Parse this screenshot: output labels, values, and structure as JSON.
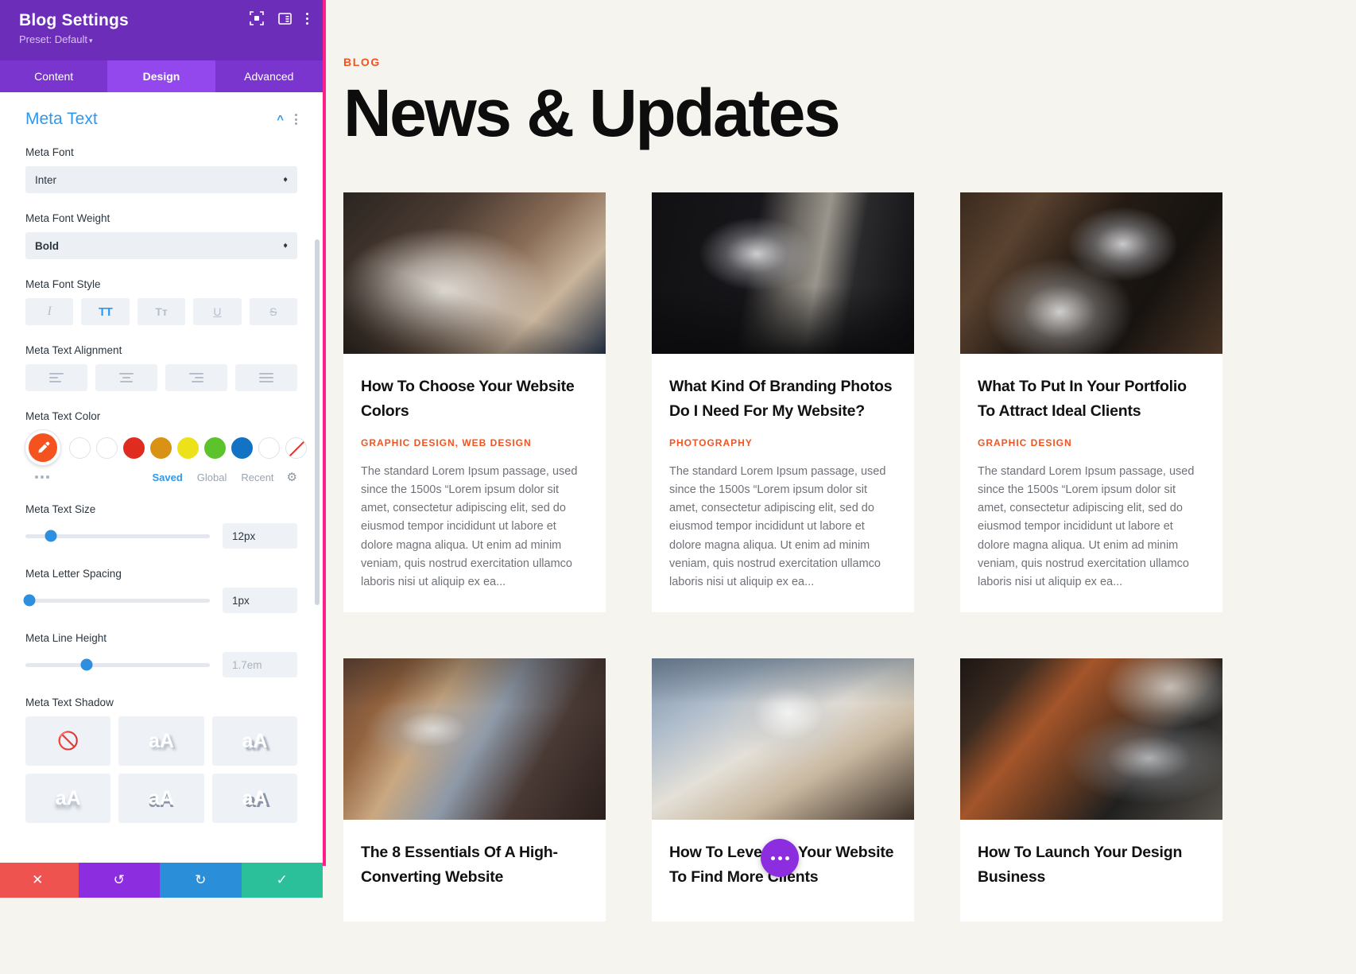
{
  "panel": {
    "title": "Blog Settings",
    "preset": "Preset: Default",
    "preset_caret": "▾",
    "icons": {
      "focus": "focus-icon",
      "layout": "layout-icon",
      "more": "more-vertical-icon"
    },
    "tabs": [
      {
        "label": "Content",
        "active": false
      },
      {
        "label": "Design",
        "active": true
      },
      {
        "label": "Advanced",
        "active": false
      }
    ],
    "section": {
      "title": "Meta Text",
      "collapse_icon": "chevron-up-icon",
      "more_icon": "more-vertical-icon"
    },
    "fields": {
      "meta_font": {
        "label": "Meta Font",
        "value": "Inter"
      },
      "meta_font_weight": {
        "label": "Meta Font Weight",
        "value": "Bold"
      },
      "meta_font_style": {
        "label": "Meta Font Style",
        "buttons": [
          {
            "name": "italic",
            "glyph": "I",
            "active": false
          },
          {
            "name": "uppercase",
            "glyph": "TT",
            "active": true
          },
          {
            "name": "small-caps",
            "glyph": "Tт",
            "active": false
          },
          {
            "name": "underline",
            "glyph": "U",
            "active": false
          },
          {
            "name": "strikethrough",
            "glyph": "S",
            "active": false
          }
        ]
      },
      "meta_text_alignment": {
        "label": "Meta Text Alignment",
        "buttons": [
          "left",
          "center",
          "right",
          "justify"
        ]
      },
      "meta_text_color": {
        "label": "Meta Text Color",
        "selected": "#f4531f",
        "swatches": [
          "#ffffff",
          "#ffffff",
          "#e02b20",
          "#d99213",
          "#ede21a",
          "#5cc32c",
          "#1272c4",
          "#ffffff",
          "none"
        ],
        "tabs": [
          {
            "label": "Saved",
            "active": true
          },
          {
            "label": "Global",
            "active": false
          },
          {
            "label": "Recent",
            "active": false
          }
        ],
        "gear_icon": "gear-icon"
      },
      "meta_text_size": {
        "label": "Meta Text Size",
        "value": "12px",
        "pct": 14
      },
      "meta_letter_spacing": {
        "label": "Meta Letter Spacing",
        "value": "1px",
        "pct": 2
      },
      "meta_line_height": {
        "label": "Meta Line Height",
        "value": "1.7em",
        "pct": 33,
        "is_placeholder": true
      },
      "meta_text_shadow": {
        "label": "Meta Text Shadow",
        "options": [
          "none",
          "aA",
          "aA",
          "aA",
          "aA",
          "aA"
        ]
      }
    },
    "footer": [
      {
        "name": "close",
        "glyph": "✕"
      },
      {
        "name": "undo",
        "glyph": "↺"
      },
      {
        "name": "redo",
        "glyph": "↻"
      },
      {
        "name": "save",
        "glyph": "✓"
      }
    ]
  },
  "page": {
    "eyebrow": "BLOG",
    "title": "News & Updates",
    "excerpt": "The standard Lorem Ipsum passage, used since the 1500s “Lorem ipsum dolor sit amet, consectetur adipiscing elit, sed do eiusmod tempor incididunt ut labore et dolore magna aliqua. Ut enim ad minim veniam, quis nostrud exercitation ullamco laboris nisi ut aliquip ex ea...",
    "cards": [
      {
        "title": "How To Choose Your Website Colors",
        "meta": "GRAPHIC DESIGN, WEB DESIGN",
        "image": "woman-sketching-wireframe"
      },
      {
        "title": "What Kind Of Branding Photos Do I Need For My Website?",
        "meta": "PHOTOGRAPHY",
        "image": "imac-on-desk-by-window"
      },
      {
        "title": "What To Put In Your Portfolio To Attract Ideal Clients",
        "meta": "GRAPHIC DESIGN",
        "image": "laptop-and-chair-on-wood-desk"
      },
      {
        "title": "The 8 Essentials Of A High-Converting Website",
        "meta": "",
        "image": "woman-with-laptop-on-rug"
      },
      {
        "title": "How To Leverage Your Website To Find More Clients",
        "meta": "",
        "image": "laptop-coffee-and-glasses"
      },
      {
        "title": "How To Launch Your Design Business",
        "meta": "",
        "image": "hands-typing-on-laptop"
      }
    ],
    "fab": "more-options-button"
  }
}
